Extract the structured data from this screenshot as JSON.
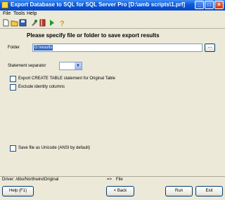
{
  "window": {
    "title": "Export Database to SQL for SQL Server Pro [D:\\amb scripts\\1.prf]",
    "controls": {
      "minimize": "_",
      "maximize": "□",
      "close": "×"
    }
  },
  "menu": {
    "file": "File",
    "tools": "Tools",
    "help": "Help"
  },
  "toolbar_icons": [
    "new-icon",
    "open-icon",
    "save-icon",
    "run-setup-icon",
    "book-icon",
    "play-icon",
    "help-icon"
  ],
  "heading": "Please specify file or folder to save export results",
  "folder": {
    "label": "Folder",
    "value": "D:\\results",
    "browse_label": "..."
  },
  "separator": {
    "label": "Statement separator",
    "value": ""
  },
  "options": {
    "create_table": "Export CREATE TABLE statement for Original Table",
    "exclude_identity": "Exclude identity columns",
    "unicode": "Save file as Unicode (ANSI by default)"
  },
  "status": {
    "driver": "Driver: /dbo/NorthwindOriginal",
    "arrows": "=>",
    "target": "File"
  },
  "buttons": {
    "help": "Help (F1)",
    "back": "< Back",
    "run": "Run",
    "exit": "Exit"
  },
  "colors": {
    "titlebar": "#0a58d8",
    "face": "#ece9d8",
    "selection": "#316ac5"
  }
}
